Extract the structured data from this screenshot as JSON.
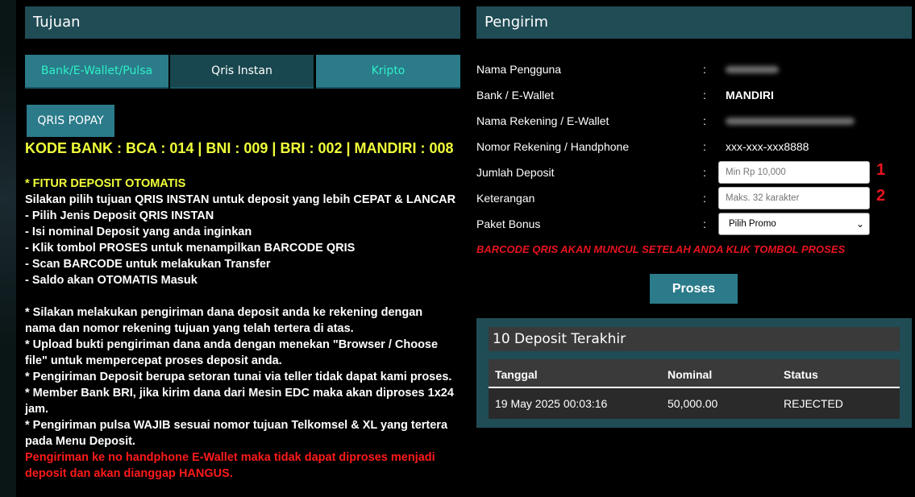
{
  "tujuan": {
    "title": "Tujuan",
    "tabs": [
      {
        "label": "Bank/E-Wallet/Pulsa",
        "active": false
      },
      {
        "label": "Qris Instan",
        "active": true
      },
      {
        "label": "Kripto",
        "active": false
      }
    ],
    "qris_button": "QRIS POPAY",
    "kode_bank": "KODE BANK : BCA : 014 | BNI : 009 | BRI : 002 | MANDIRI : 008",
    "fitur_heading": "* FITUR DEPOSIT OTOMATIS",
    "steps": [
      "Silakan pilih tujuan QRIS INSTAN untuk deposit yang lebih CEPAT & LANCAR",
      "- Pilih Jenis Deposit QRIS INSTAN",
      "- Isi nominal Deposit yang anda inginkan",
      "- Klik tombol PROSES untuk menampilkan BARCODE QRIS",
      "- Scan BARCODE untuk melakukan Transfer",
      "- Saldo akan OTOMATIS Masuk"
    ],
    "notes": [
      "* Silakan melakukan pengiriman dana deposit anda ke rekening dengan",
      "nama dan nomor rekening tujuan yang telah tertera di atas.",
      "* Upload bukti pengiriman dana anda dengan menekan \"Browser / Choose",
      "file\" untuk mempercepat proses deposit anda.",
      "* Pengiriman Deposit berupa setoran tunai via teller tidak dapat kami proses.",
      "* Member Bank BRI, jika kirim dana dari Mesin EDC maka akan diproses 1x24",
      "jam.",
      "* Pengiriman pulsa WAJIB sesuai nomor tujuan Telkomsel & XL yang tertera",
      "pada Menu Deposit."
    ],
    "warning": [
      "Pengiriman ke no handphone E-Wallet maka tidak dapat diproses menjadi",
      "deposit dan akan dianggap HANGUS."
    ]
  },
  "pengirim": {
    "title": "Pengirim",
    "colon": ":",
    "labels": {
      "nama_pengguna": "Nama Pengguna",
      "bank": "Bank / E-Wallet",
      "nama_rekening": "Nama Rekening / E-Wallet",
      "nomor_rekening": "Nomor Rekening / Handphone",
      "jumlah": "Jumlah Deposit",
      "keterangan": "Keterangan",
      "paket": "Paket Bonus"
    },
    "values": {
      "bank": "MANDIRI",
      "nomor_rekening": "xxx-xxx-xxx8888"
    },
    "placeholders": {
      "jumlah": "Min Rp 10,000",
      "keterangan": "Maks. 32 karakter"
    },
    "paket_selected": "Pilih Promo",
    "markers": [
      "1",
      "2"
    ],
    "barcode_note": "BARCODE QRIS AKAN MUNCUL SETELAH ANDA KLIK TOMBOL PROSES",
    "proses_button": "Proses"
  },
  "history": {
    "title": "10 Deposit Terakhir",
    "columns": [
      "Tanggal",
      "Nominal",
      "Status"
    ],
    "rows": [
      [
        "19 May 2025 00:03:16",
        "50,000.00",
        "REJECTED"
      ]
    ]
  },
  "colors": {
    "header_bg": "#204c55",
    "button_bg": "#2b7b8a",
    "highlight_yellow": "#f0ff3a",
    "warning_red": "#e8141e",
    "tab_text": "#2ff0c6"
  }
}
